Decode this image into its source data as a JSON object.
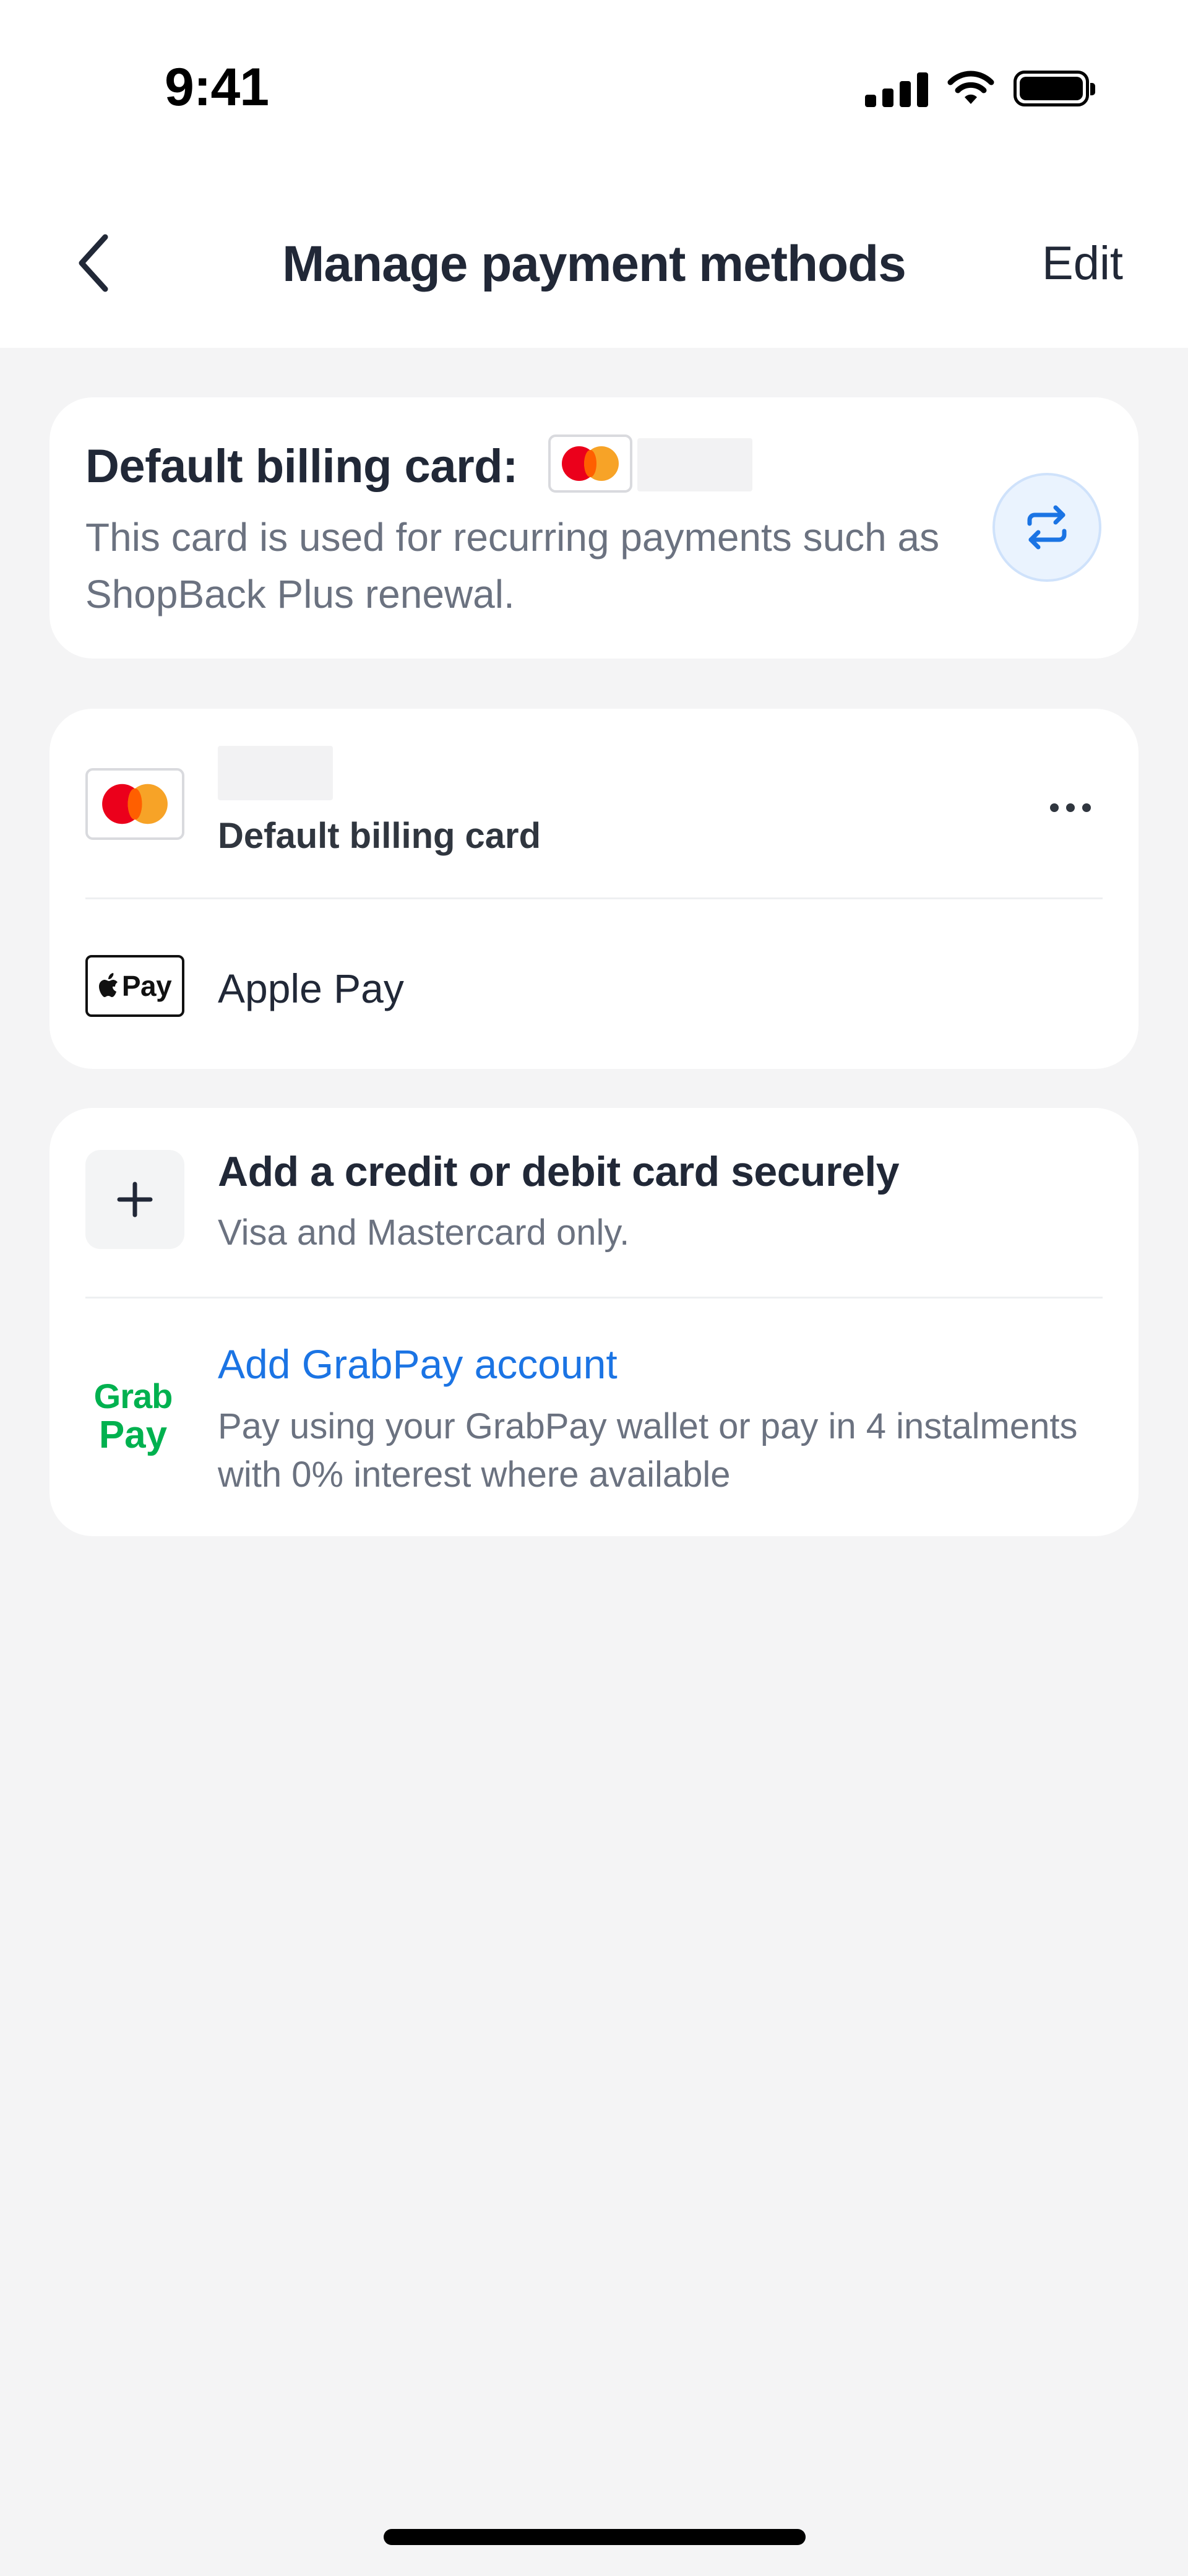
{
  "status_bar": {
    "time": "9:41",
    "icons": [
      "signal-icon",
      "wifi-icon",
      "battery-icon"
    ]
  },
  "header": {
    "title": "Manage payment methods",
    "back_icon": "chevron-left-icon",
    "edit_label": "Edit"
  },
  "billing_card": {
    "title": "Default billing card:",
    "brand_icon": "mastercard-icon",
    "description": "This card is used for recurring payments such as ShopBack Plus renewal.",
    "change_icon": "swap-arrows-icon"
  },
  "saved_methods": [
    {
      "icon": "mastercard-icon",
      "label": "Default billing card",
      "menu_icon": "more-horizontal-icon"
    },
    {
      "icon": "apple-pay-icon",
      "label": "Apple Pay",
      "badge_text": "Pay"
    }
  ],
  "add_methods": {
    "card": {
      "title": "Add a credit or debit card securely",
      "subtitle": "Visa and Mastercard only.",
      "icon": "plus-icon"
    },
    "grabpay": {
      "logo_line1": "Grab",
      "logo_line2": "Pay",
      "title": "Add GrabPay account",
      "subtitle": "Pay using your GrabPay wallet or pay in 4 instalments with 0% interest where available"
    }
  },
  "colors": {
    "background": "#F4F4F5",
    "card": "#FFFFFF",
    "text_primary": "#212837",
    "text_secondary": "#6B7280",
    "link_blue": "#1B74E4",
    "grab_green": "#00B14F",
    "mastercard_red": "#EB001B",
    "mastercard_orange": "#F79E1B"
  }
}
